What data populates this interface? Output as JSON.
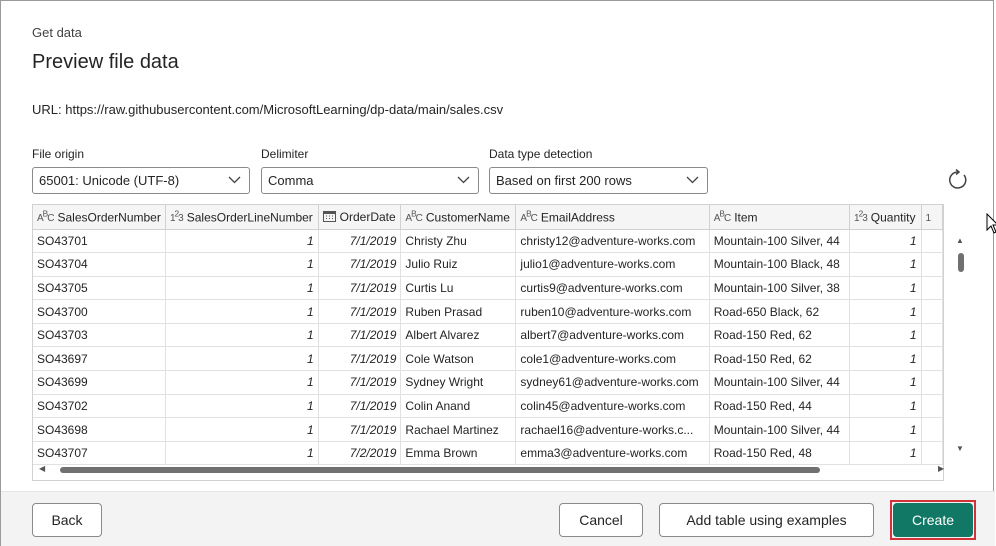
{
  "header": {
    "breadcrumb": "Get data",
    "title": "Preview file data",
    "url_label": "URL:",
    "url_value": "https://raw.githubusercontent.com/MicrosoftLearning/dp-data/main/sales.csv"
  },
  "options": {
    "file_origin_label": "File origin",
    "file_origin_value": "65001: Unicode (UTF-8)",
    "delimiter_label": "Delimiter",
    "delimiter_value": "Comma",
    "detection_label": "Data type detection",
    "detection_value": "Based on first 200 rows"
  },
  "table": {
    "columns": [
      {
        "icon": "ABC",
        "name": "SalesOrderNumber"
      },
      {
        "icon": "123",
        "name": "SalesOrderLineNumber"
      },
      {
        "icon": "calendar",
        "name": "OrderDate"
      },
      {
        "icon": "ABC",
        "name": "CustomerName"
      },
      {
        "icon": "ABC",
        "name": "EmailAddress"
      },
      {
        "icon": "ABC",
        "name": "Item"
      },
      {
        "icon": "123",
        "name": "Quantity"
      },
      {
        "icon": "123",
        "name": ""
      }
    ],
    "rows": [
      [
        "SO43701",
        "1",
        "7/1/2019",
        "Christy Zhu",
        "christy12@adventure-works.com",
        "Mountain-100 Silver, 44",
        "1"
      ],
      [
        "SO43704",
        "1",
        "7/1/2019",
        "Julio Ruiz",
        "julio1@adventure-works.com",
        "Mountain-100 Black, 48",
        "1"
      ],
      [
        "SO43705",
        "1",
        "7/1/2019",
        "Curtis Lu",
        "curtis9@adventure-works.com",
        "Mountain-100 Silver, 38",
        "1"
      ],
      [
        "SO43700",
        "1",
        "7/1/2019",
        "Ruben Prasad",
        "ruben10@adventure-works.com",
        "Road-650 Black, 62",
        "1"
      ],
      [
        "SO43703",
        "1",
        "7/1/2019",
        "Albert Alvarez",
        "albert7@adventure-works.com",
        "Road-150 Red, 62",
        "1"
      ],
      [
        "SO43697",
        "1",
        "7/1/2019",
        "Cole Watson",
        "cole1@adventure-works.com",
        "Road-150 Red, 62",
        "1"
      ],
      [
        "SO43699",
        "1",
        "7/1/2019",
        "Sydney Wright",
        "sydney61@adventure-works.com",
        "Mountain-100 Silver, 44",
        "1"
      ],
      [
        "SO43702",
        "1",
        "7/1/2019",
        "Colin Anand",
        "colin45@adventure-works.com",
        "Road-150 Red, 44",
        "1"
      ],
      [
        "SO43698",
        "1",
        "7/1/2019",
        "Rachael Martinez",
        "rachael16@adventure-works.c...",
        "Mountain-100 Silver, 44",
        "1"
      ],
      [
        "SO43707",
        "1",
        "7/2/2019",
        "Emma Brown",
        "emma3@adventure-works.com",
        "Road-150 Red, 48",
        "1"
      ]
    ]
  },
  "footer": {
    "back_label": "Back",
    "cancel_label": "Cancel",
    "examples_label": "Add table using examples",
    "create_label": "Create"
  },
  "colors": {
    "primary": "#117865",
    "highlight": "#d13438"
  }
}
